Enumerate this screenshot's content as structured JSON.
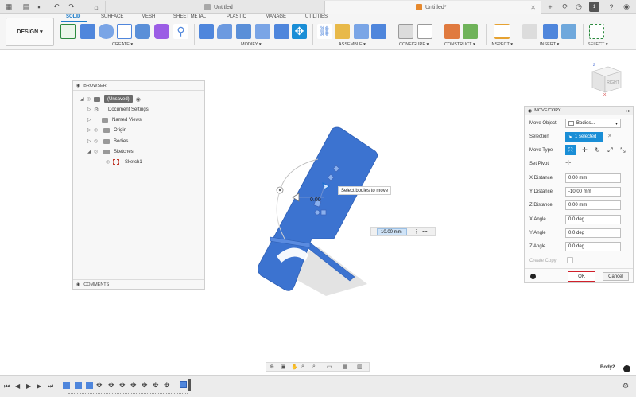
{
  "titlebar": {
    "tabs": [
      {
        "label": "Untitled",
        "active": false
      },
      {
        "label": "Untitled*",
        "active": true
      }
    ],
    "notification_count": "1"
  },
  "ribbon": {
    "workspace_button": "DESIGN",
    "workspace_tabs": [
      "SOLID",
      "SURFACE",
      "MESH",
      "SHEET METAL",
      "PLASTIC",
      "MANAGE",
      "UTILITIES"
    ],
    "groups": [
      "CREATE",
      "MODIFY",
      "ASSEMBLE",
      "CONFIGURE",
      "CONSTRUCT",
      "INSPECT",
      "INSERT",
      "SELECT"
    ]
  },
  "browser": {
    "title": "BROWSER",
    "root": "(Unsaved)",
    "items": [
      "Document Settings",
      "Named Views",
      "Origin",
      "Bodies",
      "Sketches",
      "Sketch1"
    ],
    "footer": "COMMENTS"
  },
  "viewport": {
    "tooltip": "Select bodies to move",
    "distance_value": "-10.00 mm",
    "angle_readout": "0.00"
  },
  "panel": {
    "title": "MOVE/COPY",
    "move_object_label": "Move Object",
    "move_object_value": "Bodies...",
    "selection_label": "Selection",
    "selection_value": "1 selected",
    "move_type_label": "Move Type",
    "set_pivot_label": "Set Pivot",
    "fields": [
      {
        "label": "X Distance",
        "value": "0.00 mm"
      },
      {
        "label": "Y Distance",
        "value": "-10.00 mm"
      },
      {
        "label": "Z Distance",
        "value": "0.00 mm"
      },
      {
        "label": "X Angle",
        "value": "0.0 deg"
      },
      {
        "label": "Y Angle",
        "value": "0.0 deg"
      },
      {
        "label": "Z Angle",
        "value": "0.0 deg"
      }
    ],
    "create_copy_label": "Create Copy",
    "ok_label": "OK",
    "cancel_label": "Cancel"
  },
  "viewcube_label": "RIGHT",
  "status": {
    "body_label": "Body2"
  },
  "colors": {
    "accent": "#1f7dc9",
    "body": "#3c73d0",
    "ok_border": "#d0202a"
  }
}
